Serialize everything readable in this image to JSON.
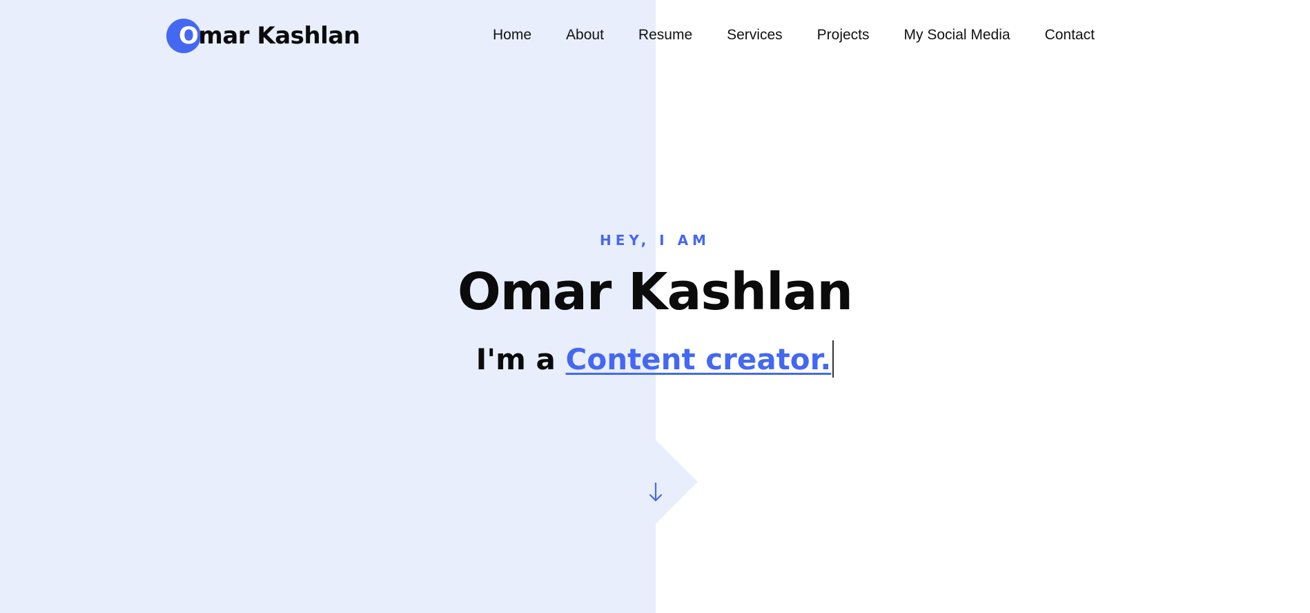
{
  "brand": {
    "first_letter": "O",
    "rest_name": "mar Kashlan",
    "accent_color": "#4468f2",
    "panel_color": "#e9eefc"
  },
  "nav": {
    "items": [
      {
        "label": "Home"
      },
      {
        "label": "About"
      },
      {
        "label": "Resume"
      },
      {
        "label": "Services"
      },
      {
        "label": "Projects"
      },
      {
        "label": "My Social Media"
      },
      {
        "label": "Contact"
      }
    ]
  },
  "hero": {
    "kicker": "HEY, I AM",
    "name": "Omar Kashlan",
    "intro_prefix": "I'm a",
    "role": "Content creator."
  },
  "scroll": {
    "icon": "arrow-down-icon"
  }
}
